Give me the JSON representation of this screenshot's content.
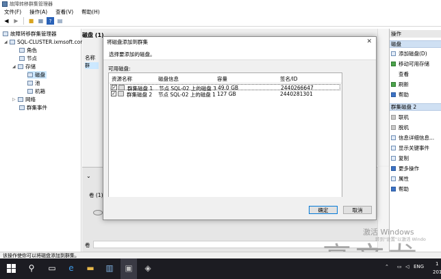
{
  "window": {
    "title": "故障转移群集管理器"
  },
  "menu": [
    "文件(F)",
    "操作(A)",
    "查看(V)",
    "帮助(H)"
  ],
  "tree": {
    "root": "故障转移群集管理器",
    "cluster": "SQL-CLUSTER.ixmsoft.com",
    "roles": "角色",
    "nodes": "节点",
    "storage": "存储",
    "disks": "磁盘",
    "pools": "池",
    "enclosures": "机箱",
    "networks": "网络",
    "cluster_events": "群集事件"
  },
  "center": {
    "header": "磁盘 (1)",
    "col_name": "名称",
    "row_name": "群",
    "volume_label": "卷 (1)",
    "volume_label2": "卷"
  },
  "dialog": {
    "title": "将磁盘添加到群集",
    "close": "✕",
    "prompt": "选择要添加的磁盘。",
    "available_label": "可用磁盘:",
    "columns": {
      "resource": "资源名称",
      "disk_info": "磁盘信息",
      "capacity": "容量",
      "signature": "签名/ID"
    },
    "rows": [
      {
        "checked": true,
        "resource": "群集磁盘 1",
        "disk_info": "节点 SQL-02 上的磁盘 3",
        "capacity": "49.0 GB",
        "signature": "2440266647"
      },
      {
        "checked": true,
        "resource": "群集磁盘 2",
        "disk_info": "节点 SQL-02 上的磁盘 1",
        "capacity": "127 GB",
        "signature": "2440281301"
      }
    ],
    "ok_label": "确定",
    "cancel_label": "取消"
  },
  "actions": {
    "header": "操作",
    "section1": "磁盘",
    "items1": [
      "添加磁盘(D)",
      "移动可用存储",
      "查看",
      "刷新",
      "帮助"
    ],
    "section2": "群集磁盘 2",
    "items2": [
      "联机",
      "脱机",
      "信息详细信息...",
      "显示关键事件",
      "复制",
      "更多操作",
      "属性",
      "帮助"
    ]
  },
  "status": {
    "text": "该操作使你可以将磁盘添加到群集。"
  },
  "watermark": {
    "activate": "激活 Windows",
    "goto": "转到\"设置\"以激活 Windo",
    "author": "高文龙"
  },
  "taskbar": {
    "lang": "ENG",
    "time": "1",
    "year": "201"
  }
}
